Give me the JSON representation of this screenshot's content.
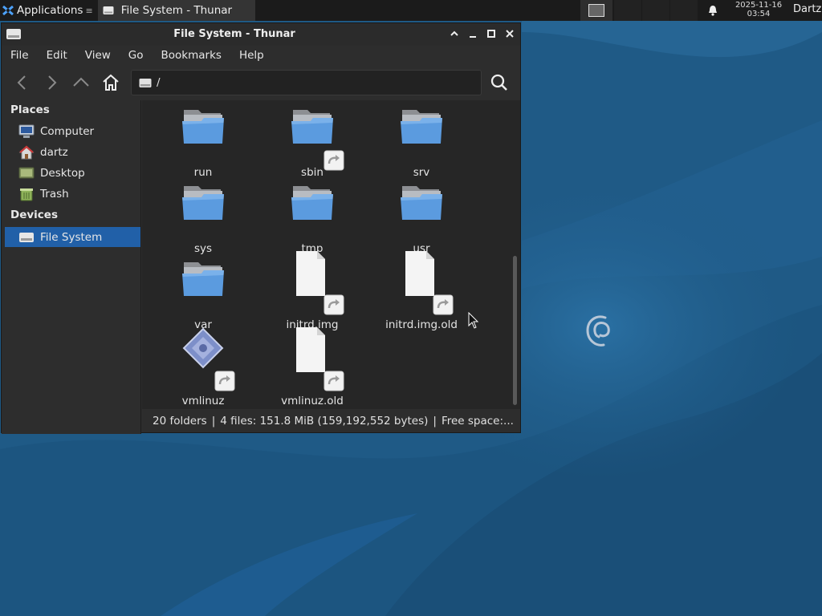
{
  "panel": {
    "applications_label": "Applications",
    "task_label": "File System - Thunar",
    "clock_date": "2025-11-16",
    "clock_time": "03:54",
    "user": "Dartz"
  },
  "window": {
    "title": "File System - Thunar",
    "menu": [
      "File",
      "Edit",
      "View",
      "Go",
      "Bookmarks",
      "Help"
    ],
    "location_path": "/"
  },
  "sidebar": {
    "places_heading": "Places",
    "places": [
      {
        "label": "Computer",
        "icon": "computer-icon"
      },
      {
        "label": "dartz",
        "icon": "home-folder-icon"
      },
      {
        "label": "Desktop",
        "icon": "desktop-icon"
      },
      {
        "label": "Trash",
        "icon": "trash-icon"
      }
    ],
    "devices_heading": "Devices",
    "devices": [
      {
        "label": "File System",
        "icon": "drive-icon",
        "selected": true
      }
    ]
  },
  "files": [
    {
      "name": "run",
      "type": "folder",
      "link": false
    },
    {
      "name": "sbin",
      "type": "folder",
      "link": true
    },
    {
      "name": "srv",
      "type": "folder",
      "link": false
    },
    {
      "name": "sys",
      "type": "folder",
      "link": false
    },
    {
      "name": "tmp",
      "type": "folder",
      "link": false
    },
    {
      "name": "usr",
      "type": "folder",
      "link": false
    },
    {
      "name": "var",
      "type": "folder",
      "link": false
    },
    {
      "name": "initrd.img",
      "type": "file",
      "link": true
    },
    {
      "name": "initrd.img.old",
      "type": "file",
      "link": true
    },
    {
      "name": "vmlinuz",
      "type": "kernel",
      "link": true
    },
    {
      "name": "vmlinuz.old",
      "type": "file",
      "link": true
    }
  ],
  "status": {
    "folders": "20 folders",
    "files": "4 files: 151.8 MiB (159,192,552 bytes)",
    "free": "Free space:..."
  },
  "colors": {
    "panel_bg": "#1b1b1b",
    "window_bg": "#2d2d2d",
    "selection": "#2160a8",
    "desktop": "#1f5a86"
  }
}
